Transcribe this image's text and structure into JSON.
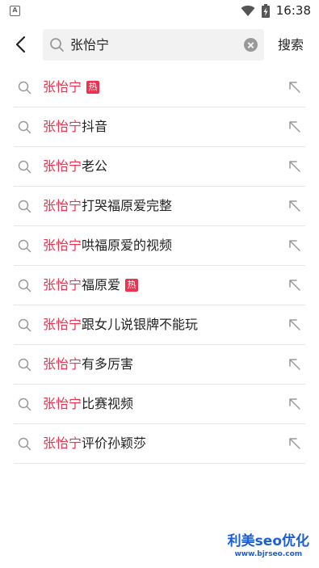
{
  "status_bar": {
    "app_icon_letter": "A",
    "time": "16:38"
  },
  "header": {
    "search_value": "张怡宁",
    "search_button_label": "搜索"
  },
  "suggestions": [
    {
      "highlight": "张怡宁",
      "rest": "",
      "badge": "热"
    },
    {
      "highlight": "张怡宁",
      "rest": "抖音",
      "badge": ""
    },
    {
      "highlight": "张怡宁",
      "rest": "老公",
      "badge": ""
    },
    {
      "highlight": "张怡宁",
      "rest": "打哭福原爱完整",
      "badge": ""
    },
    {
      "highlight": "张怡宁",
      "rest": "哄福原爱的视频",
      "badge": ""
    },
    {
      "highlight": "张怡宁",
      "rest": "福原爱",
      "badge": "热"
    },
    {
      "highlight": "张怡宁",
      "rest": "跟女儿说银牌不能玩",
      "badge": ""
    },
    {
      "highlight": "张怡宁",
      "rest": "有多厉害",
      "badge": ""
    },
    {
      "highlight": "张怡宁",
      "rest": "比赛视频",
      "badge": ""
    },
    {
      "highlight": "张怡宁",
      "rest": "评价孙颖莎",
      "badge": ""
    }
  ],
  "watermark": {
    "title": "利美seo优化",
    "url": "www.bjrseo.com"
  },
  "colors": {
    "highlight": "#f0304c",
    "hot_badge": "#f0304c",
    "watermark": "#1a5fd6"
  }
}
